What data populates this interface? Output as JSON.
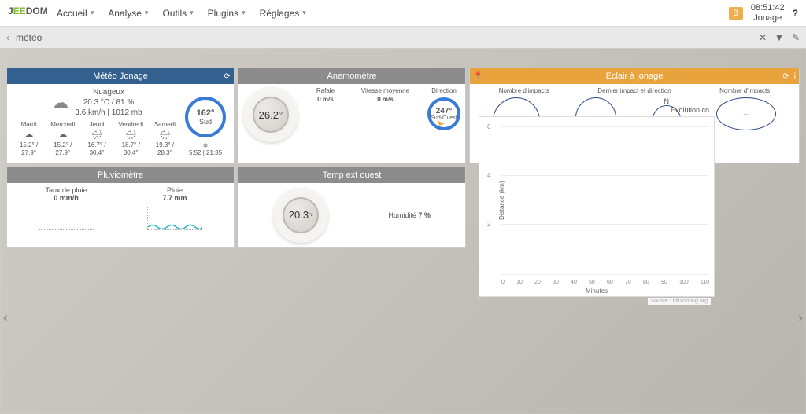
{
  "topbar": {
    "logo": "EEDOM",
    "menu": [
      "Accueil",
      "Analyse",
      "Outils",
      "Plugins",
      "Réglages"
    ],
    "badge": "3",
    "clock": "08:51:42",
    "location": "Jonage"
  },
  "search": {
    "value": "météo"
  },
  "panel_title": "Météo",
  "meteo": {
    "title": "Météo Jonage",
    "cond": "Nuageux",
    "temp_hum": "20.3 °C / 81 %",
    "wind_press": "3.6 km/h | 1012 mb",
    "current_icon": "☁",
    "compass_deg": "162°",
    "compass_dir": "Sud",
    "sun": "5:52 | 21:35",
    "sun_icon": "❄",
    "forecast": [
      {
        "day": "Mardi",
        "icon": "☁",
        "range": "15.2° / 27.9°"
      },
      {
        "day": "Mercredi",
        "icon": "☁",
        "range": "15.2° / 27.9°"
      },
      {
        "day": "Jeudi",
        "icon": "🌧",
        "range": "16.7° / 30.4°"
      },
      {
        "day": "Vendredi",
        "icon": "🌧",
        "range": "18.7° / 30.4°"
      },
      {
        "day": "Samedi",
        "icon": "🌧",
        "range": "19.3° / 28.3°"
      }
    ]
  },
  "anemo": {
    "title": "Anemomètre",
    "gauge": "26.2",
    "rafale_label": "Rafale",
    "rafale": "0 m/s",
    "vmoy_label": "Vitesse moyenne",
    "vmoy": "0 m/s",
    "dir_label": "Direction",
    "dir_deg": "247°",
    "dir_txt": "Sud-Ouest"
  },
  "eclair": {
    "title": "Eclair à jonage",
    "impacts_label": "Nombre d'impacts",
    "impacts2_label": "Nombre d'impacts",
    "center_label": "Dernier impact et direction",
    "n": "N",
    "none": "---"
  },
  "pluvio": {
    "title": "Pluviomètre",
    "rate_label": "Taux de pluie",
    "rate": "0 mm/h",
    "total_label": "Pluie",
    "total": "7.7 mm"
  },
  "tempext": {
    "title": "Temp ext ouest",
    "gauge": "20.3",
    "hum_label": "Humidité",
    "hum": "7 %"
  },
  "chart_data": {
    "type": "line",
    "title": "Evolution co",
    "ylabel": "Distance (km)",
    "xlabel": "Minutes",
    "ylim": [
      0,
      6
    ],
    "yticks": [
      2,
      4,
      6
    ],
    "x": [
      0,
      10,
      20,
      30,
      40,
      50,
      60,
      70,
      80,
      90,
      100,
      110
    ],
    "series": [
      {
        "name": "distance",
        "values": []
      }
    ],
    "source": "Source : blitzortung.org"
  }
}
